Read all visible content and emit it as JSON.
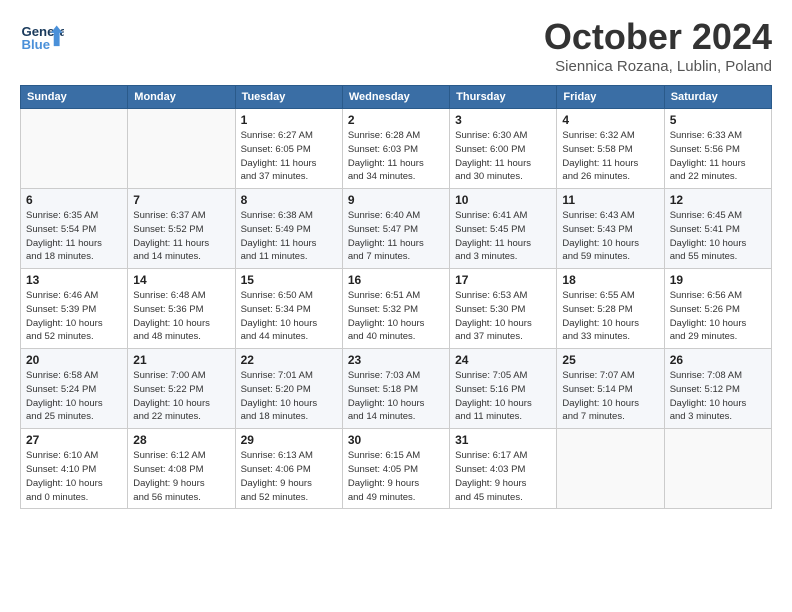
{
  "header": {
    "logo_general": "General",
    "logo_blue": "Blue",
    "title": "October 2024",
    "location": "Siennica Rozana, Lublin, Poland"
  },
  "weekdays": [
    "Sunday",
    "Monday",
    "Tuesday",
    "Wednesday",
    "Thursday",
    "Friday",
    "Saturday"
  ],
  "weeks": [
    [
      {
        "day": "",
        "info": ""
      },
      {
        "day": "",
        "info": ""
      },
      {
        "day": "1",
        "info": "Sunrise: 6:27 AM\nSunset: 6:05 PM\nDaylight: 11 hours\nand 37 minutes."
      },
      {
        "day": "2",
        "info": "Sunrise: 6:28 AM\nSunset: 6:03 PM\nDaylight: 11 hours\nand 34 minutes."
      },
      {
        "day": "3",
        "info": "Sunrise: 6:30 AM\nSunset: 6:00 PM\nDaylight: 11 hours\nand 30 minutes."
      },
      {
        "day": "4",
        "info": "Sunrise: 6:32 AM\nSunset: 5:58 PM\nDaylight: 11 hours\nand 26 minutes."
      },
      {
        "day": "5",
        "info": "Sunrise: 6:33 AM\nSunset: 5:56 PM\nDaylight: 11 hours\nand 22 minutes."
      }
    ],
    [
      {
        "day": "6",
        "info": "Sunrise: 6:35 AM\nSunset: 5:54 PM\nDaylight: 11 hours\nand 18 minutes."
      },
      {
        "day": "7",
        "info": "Sunrise: 6:37 AM\nSunset: 5:52 PM\nDaylight: 11 hours\nand 14 minutes."
      },
      {
        "day": "8",
        "info": "Sunrise: 6:38 AM\nSunset: 5:49 PM\nDaylight: 11 hours\nand 11 minutes."
      },
      {
        "day": "9",
        "info": "Sunrise: 6:40 AM\nSunset: 5:47 PM\nDaylight: 11 hours\nand 7 minutes."
      },
      {
        "day": "10",
        "info": "Sunrise: 6:41 AM\nSunset: 5:45 PM\nDaylight: 11 hours\nand 3 minutes."
      },
      {
        "day": "11",
        "info": "Sunrise: 6:43 AM\nSunset: 5:43 PM\nDaylight: 10 hours\nand 59 minutes."
      },
      {
        "day": "12",
        "info": "Sunrise: 6:45 AM\nSunset: 5:41 PM\nDaylight: 10 hours\nand 55 minutes."
      }
    ],
    [
      {
        "day": "13",
        "info": "Sunrise: 6:46 AM\nSunset: 5:39 PM\nDaylight: 10 hours\nand 52 minutes."
      },
      {
        "day": "14",
        "info": "Sunrise: 6:48 AM\nSunset: 5:36 PM\nDaylight: 10 hours\nand 48 minutes."
      },
      {
        "day": "15",
        "info": "Sunrise: 6:50 AM\nSunset: 5:34 PM\nDaylight: 10 hours\nand 44 minutes."
      },
      {
        "day": "16",
        "info": "Sunrise: 6:51 AM\nSunset: 5:32 PM\nDaylight: 10 hours\nand 40 minutes."
      },
      {
        "day": "17",
        "info": "Sunrise: 6:53 AM\nSunset: 5:30 PM\nDaylight: 10 hours\nand 37 minutes."
      },
      {
        "day": "18",
        "info": "Sunrise: 6:55 AM\nSunset: 5:28 PM\nDaylight: 10 hours\nand 33 minutes."
      },
      {
        "day": "19",
        "info": "Sunrise: 6:56 AM\nSunset: 5:26 PM\nDaylight: 10 hours\nand 29 minutes."
      }
    ],
    [
      {
        "day": "20",
        "info": "Sunrise: 6:58 AM\nSunset: 5:24 PM\nDaylight: 10 hours\nand 25 minutes."
      },
      {
        "day": "21",
        "info": "Sunrise: 7:00 AM\nSunset: 5:22 PM\nDaylight: 10 hours\nand 22 minutes."
      },
      {
        "day": "22",
        "info": "Sunrise: 7:01 AM\nSunset: 5:20 PM\nDaylight: 10 hours\nand 18 minutes."
      },
      {
        "day": "23",
        "info": "Sunrise: 7:03 AM\nSunset: 5:18 PM\nDaylight: 10 hours\nand 14 minutes."
      },
      {
        "day": "24",
        "info": "Sunrise: 7:05 AM\nSunset: 5:16 PM\nDaylight: 10 hours\nand 11 minutes."
      },
      {
        "day": "25",
        "info": "Sunrise: 7:07 AM\nSunset: 5:14 PM\nDaylight: 10 hours\nand 7 minutes."
      },
      {
        "day": "26",
        "info": "Sunrise: 7:08 AM\nSunset: 5:12 PM\nDaylight: 10 hours\nand 3 minutes."
      }
    ],
    [
      {
        "day": "27",
        "info": "Sunrise: 6:10 AM\nSunset: 4:10 PM\nDaylight: 10 hours\nand 0 minutes."
      },
      {
        "day": "28",
        "info": "Sunrise: 6:12 AM\nSunset: 4:08 PM\nDaylight: 9 hours\nand 56 minutes."
      },
      {
        "day": "29",
        "info": "Sunrise: 6:13 AM\nSunset: 4:06 PM\nDaylight: 9 hours\nand 52 minutes."
      },
      {
        "day": "30",
        "info": "Sunrise: 6:15 AM\nSunset: 4:05 PM\nDaylight: 9 hours\nand 49 minutes."
      },
      {
        "day": "31",
        "info": "Sunrise: 6:17 AM\nSunset: 4:03 PM\nDaylight: 9 hours\nand 45 minutes."
      },
      {
        "day": "",
        "info": ""
      },
      {
        "day": "",
        "info": ""
      }
    ]
  ]
}
